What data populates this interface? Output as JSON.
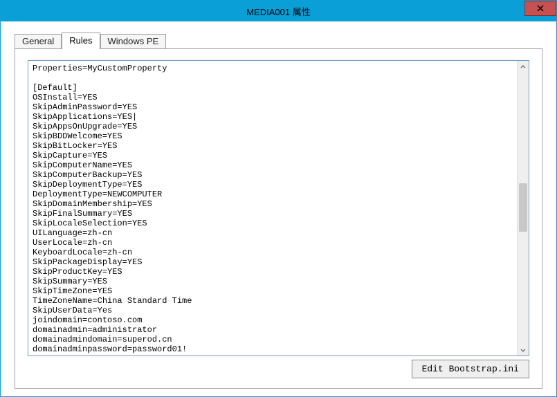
{
  "window": {
    "title": "MEDIA001 属性"
  },
  "tabs": {
    "general": "General",
    "rules": "Rules",
    "windows_pe": "Windows PE",
    "active": "rules"
  },
  "rules": {
    "text": "Properties=MyCustomProperty\n\n[Default]\nOSInstall=YES\nSkipAdminPassword=YES\nSkipApplications=YES|\nSkipAppsOnUpgrade=YES\nSkipBDDWelcome=YES\nSkipBitLocker=YES\nSkipCapture=YES\nSkipComputerName=YES\nSkipComputerBackup=YES\nSkipDeploymentType=YES\nDeploymentType=NEWCOMPUTER\nSkipDomainMembership=YES\nSkipFinalSummary=YES\nSkipLocaleSelection=YES\nUILanguage=zh-cn\nUserLocale=zh-cn\nKeyboardLocale=zh-cn\nSkipPackageDisplay=YES\nSkipProductKey=YES\nSkipSummary=YES\nSkipTimeZone=YES\nTimeZoneName=China Standard Time\nSkipUserData=Yes\njoindomain=contoso.com\ndomainadmin=administrator\ndomainadmindomain=superod.cn\ndomainadminpassword=password01!"
  },
  "buttons": {
    "edit_bootstrap": "Edit Bootstrap.ini"
  }
}
